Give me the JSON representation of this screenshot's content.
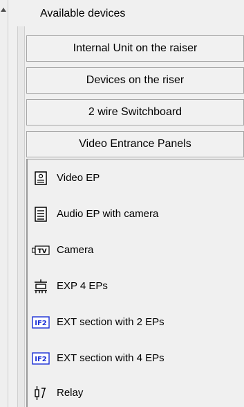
{
  "section": {
    "title": "Available devices"
  },
  "groups": [
    {
      "label": "Internal Unit on the raiser"
    },
    {
      "label": "Devices on the riser"
    },
    {
      "label": "2 wire Switchboard"
    },
    {
      "label": "Video Entrance Panels"
    }
  ],
  "devices": [
    {
      "label": "Video EP",
      "icon": "video-ep-icon"
    },
    {
      "label": "Audio EP with camera",
      "icon": "audio-ep-icon"
    },
    {
      "label": "Camera",
      "icon": "camera-icon"
    },
    {
      "label": "EXP 4 EPs",
      "icon": "expander-icon"
    },
    {
      "label": "EXT section with 2 EPs",
      "icon": "if2-icon",
      "icon_text": "IF2"
    },
    {
      "label": "EXT section with 4 EPs",
      "icon": "if2-icon",
      "icon_text": "IF2"
    },
    {
      "label": "Relay",
      "icon": "relay-icon"
    }
  ],
  "camera_icon_text": "TV",
  "colors": {
    "accent_blue": "#1a2fd6",
    "panel_bg": "#f0f0f0",
    "border": "#a6a6a6"
  }
}
